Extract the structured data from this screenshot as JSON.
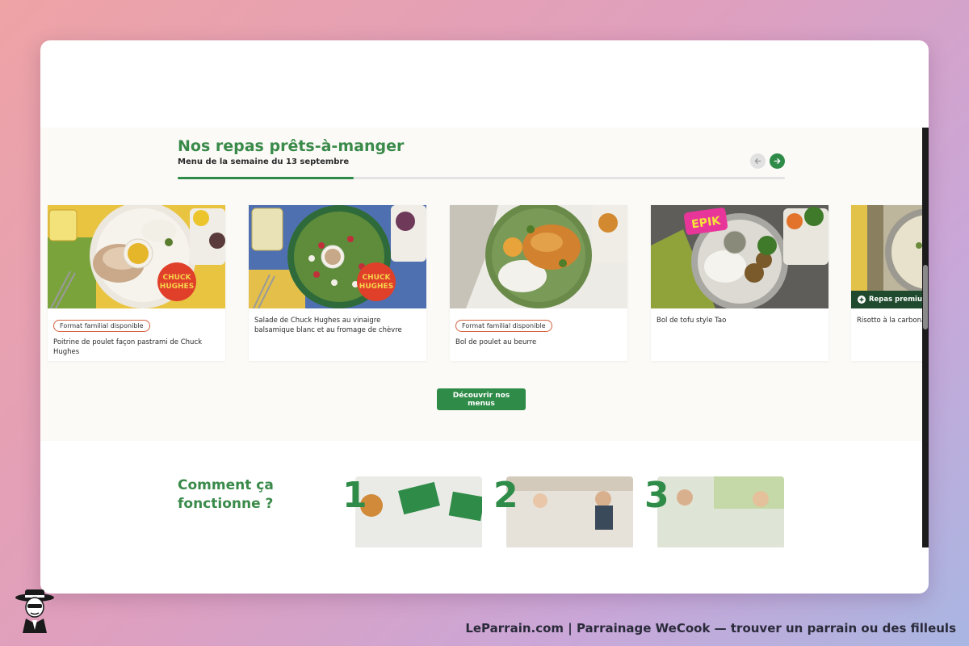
{
  "meals": {
    "title": "Nos repas prêts-à-manger",
    "subtitle": "Menu de la semaine du 13 septembre",
    "progress": 0.29,
    "prev_label": "Précédent",
    "next_label": "Suivant",
    "cards": [
      {
        "name": "Poitrine de poulet façon pastrami de Chuck Hughes",
        "badge": "Format familial disponible",
        "image_brand": "CHUCK HUGHES"
      },
      {
        "name": "Salade de Chuck Hughes au vinaigre balsamique blanc et au fromage de chèvre",
        "badge": "",
        "image_brand": "CHUCK HUGHES"
      },
      {
        "name": "Bol de poulet au beurre",
        "badge": "Format familial disponible",
        "image_brand": ""
      },
      {
        "name": "Bol de tofu style Tao",
        "badge": "",
        "image_brand": "EPIK"
      },
      {
        "name": "Risotto à la carbona",
        "badge": "",
        "premium": "Repas premium",
        "image_brand": ""
      }
    ],
    "cta_label": "Découvrir nos menus"
  },
  "how": {
    "title": "Comment ça fonctionne ?",
    "steps": [
      {
        "number": "1",
        "image": "wecook-boxes-photo"
      },
      {
        "number": "2",
        "image": "people-kitchen-photo"
      },
      {
        "number": "3",
        "image": "couple-photo"
      }
    ]
  },
  "footer": {
    "text": "LeParrain.com | Parrainage WeCook — trouver un parrain ou des filleuls"
  },
  "colors": {
    "brand_green": "#2f8b48",
    "title_green": "#3a8a4a",
    "badge_border": "#d5603e",
    "premium_bg": "#1f4a2d"
  }
}
